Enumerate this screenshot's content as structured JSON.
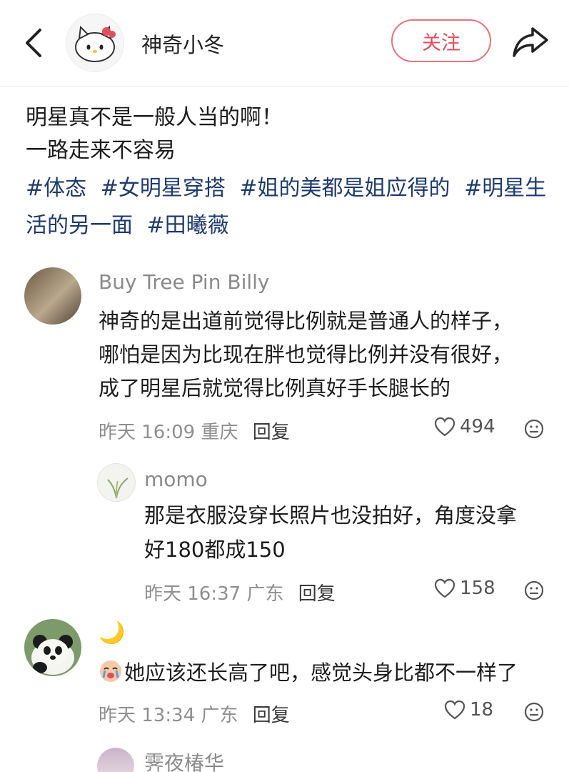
{
  "header": {
    "author_name": "神奇小冬",
    "follow_label": "关注"
  },
  "post": {
    "lines": [
      "明星真不是一般人当的啊！",
      "一路走来不容易"
    ],
    "tags": [
      "#体态",
      "#女明星穿搭",
      "#姐的美都是姐应得的",
      "#明星生",
      "活的另一面",
      "#田曦薇"
    ]
  },
  "comments": [
    {
      "username": "Buy Tree Pin Billy",
      "lines": [
        "神奇的是出道前觉得比例就是普通人的样子，",
        "哪怕是因为比现在胖也觉得比例并没有很好，",
        "成了明星后就觉得比例真好手长腿长的"
      ],
      "time": "昨天 16:09",
      "location": "重庆",
      "reply_label": "回复",
      "likes": "494"
    },
    {
      "username": "momo",
      "lines": [
        "那是衣服没穿长照片也没拍好，角度没拿",
        "好180都成150"
      ],
      "time": "昨天 16:37",
      "location": "广东",
      "reply_label": "回复",
      "likes": "158"
    },
    {
      "username": "🌙",
      "lines": [
        "她应该还长高了吧，感觉头身比都不一样了"
      ],
      "time": "昨天 13:34",
      "location": "广东",
      "reply_label": "回复",
      "likes": "18"
    },
    {
      "username": "霁夜椿华"
    }
  ],
  "icons": [
    "back-arrow-icon",
    "share-icon",
    "heart-icon",
    "emoji-face-icon",
    "crying-face-emoji"
  ],
  "colors": {
    "follow_accent": "#e0505c",
    "hashtag": "#1e3a6e",
    "meta_gray": "#8f8f8f"
  }
}
